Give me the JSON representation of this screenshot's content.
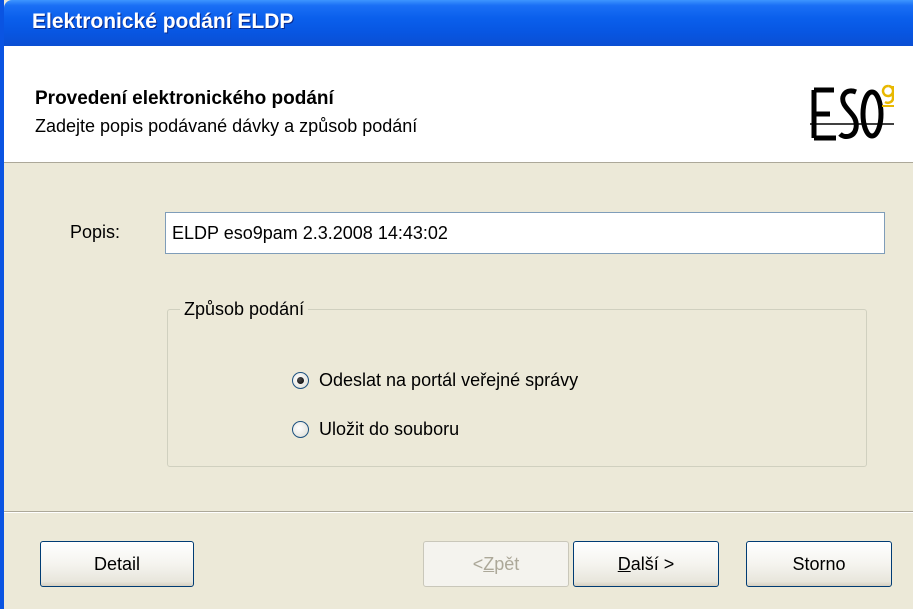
{
  "window": {
    "title": "Elektronické podání ELDP"
  },
  "header": {
    "title": "Provedení elektronického podání",
    "subtitle": "Zadejte popis podávané dávky a způsob podání",
    "logo_text": "ESO9"
  },
  "form": {
    "popis_label": "Popis:",
    "popis_value": "ELDP eso9pam 2.3.2008 14:43:02"
  },
  "group": {
    "legend": "Způsob podání",
    "options": [
      {
        "label": "Odeslat na portál veřejné správy",
        "checked": true
      },
      {
        "label": "Uložit do souboru",
        "checked": false
      }
    ]
  },
  "buttons": {
    "detail": "Detail",
    "back_prefix": "< ",
    "back_accel": "Z",
    "back_rest": "pět",
    "next_accel": "D",
    "next_rest": "alší >",
    "cancel": "Storno"
  },
  "colors": {
    "titlebar": "#0a5fec",
    "dialog_bg": "#ece9d8",
    "logo_accent": "#e8b800"
  }
}
